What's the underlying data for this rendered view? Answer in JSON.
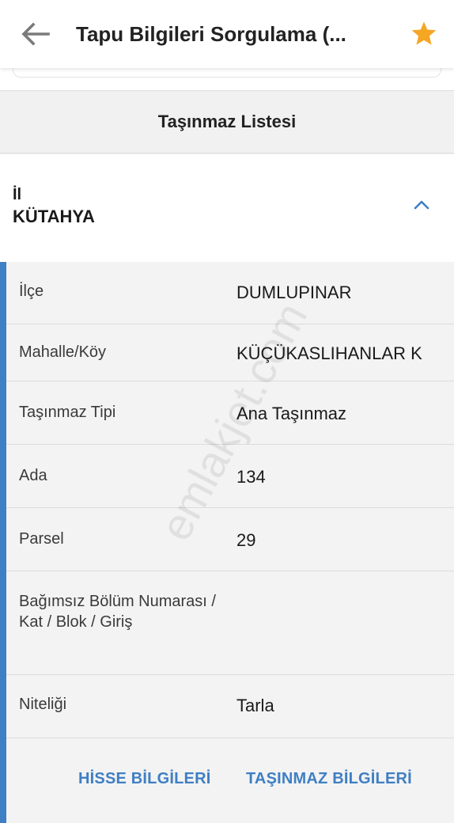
{
  "header": {
    "title": "Tapu Bilgileri Sorgulama (...",
    "back_icon": "arrow-left-icon",
    "favorite_icon": "star-icon",
    "favorite_color": "#F5A623"
  },
  "list": {
    "title": "Taşınmaz Listesi"
  },
  "province": {
    "label": "İl",
    "value": "KÜTAHYA",
    "toggle_icon": "chevron-up-icon"
  },
  "details": [
    {
      "label": "İlçe",
      "value": "DUMLUPINAR"
    },
    {
      "label": "Mahalle/Köy",
      "value": "KÜÇÜKASLIHANLAR K"
    },
    {
      "label": "Taşınmaz Tipi",
      "value": "Ana Taşınmaz"
    },
    {
      "label": "Ada",
      "value": "134"
    },
    {
      "label": "Parsel",
      "value": "29"
    },
    {
      "label": "Bağımsız Bölüm Numarası / Kat / Blok / Giriş",
      "value": ""
    },
    {
      "label": "Niteliği",
      "value": "Tarla"
    }
  ],
  "actions": {
    "share_info": "HİSSE BİLGİLERİ",
    "property_info": "TAŞINMAZ BİLGİLERİ"
  },
  "watermark": "emlakjet.com",
  "colors": {
    "accent": "#3F7FC3"
  }
}
